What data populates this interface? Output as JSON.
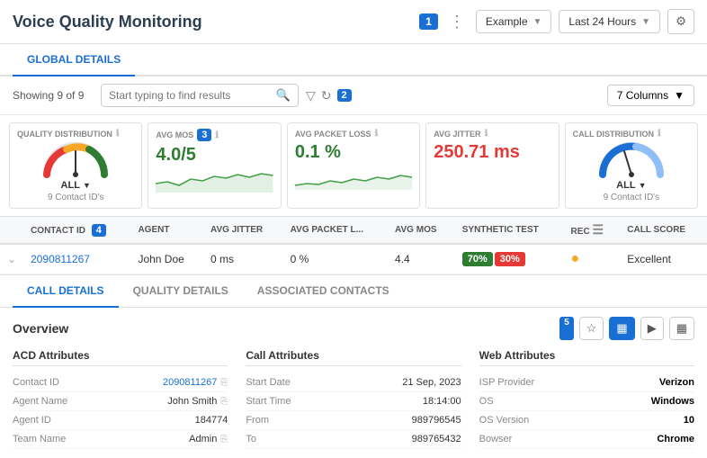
{
  "header": {
    "title": "Voice Quality Monitoring",
    "badge1": "1",
    "example_label": "Example",
    "time_label": "Last 24 Hours",
    "filter_icon": "⚙"
  },
  "global_details_tab": "GLOBAL DETAILS",
  "toolbar": {
    "showing": "Showing 9 of 9",
    "search_placeholder": "Start typing to find results",
    "badge2": "2",
    "columns_label": "7 Columns"
  },
  "metrics": [
    {
      "label": "QUALITY DISTRIBUTION",
      "type": "gauge",
      "tag": "ALL",
      "sub": "9 Contact ID's"
    },
    {
      "label": "AVG MOS",
      "badge": "3",
      "value": "4.0/5",
      "type": "sparkline_green"
    },
    {
      "label": "AVG PACKET LOSS",
      "value": "0.1 %",
      "type": "sparkline_green"
    },
    {
      "label": "AVG JITTER",
      "value": "250.71 ms",
      "type": "plain",
      "color": "red"
    },
    {
      "label": "CALL DISTRIBUTION",
      "type": "gauge_blue",
      "tag": "ALL",
      "sub": "9 Contact ID's"
    }
  ],
  "table": {
    "columns": [
      "CONTACT ID",
      "AGENT",
      "AVG JITTER",
      "AVG PACKET L...",
      "AVG MOS",
      "SYNTHETIC TEST",
      "REC",
      "CALL SCORE"
    ],
    "badge4": "4",
    "rows": [
      {
        "contact_id": "2090811267",
        "agent": "John Doe",
        "avg_jitter": "0 ms",
        "avg_packet_loss": "0 %",
        "avg_mos": "4.4",
        "synthetic_green": "70%",
        "synthetic_red": "30%",
        "rec": "●",
        "call_score": "Excellent"
      }
    ]
  },
  "detail_tabs": [
    "CALL DETAILS",
    "QUALITY DETAILS",
    "ASSOCIATED CONTACTS"
  ],
  "overview": {
    "title": "Overview",
    "badge5": "5"
  },
  "acd_attributes": {
    "title": "ACD Attributes",
    "rows": [
      {
        "key": "Contact ID",
        "value": "2090811267",
        "link": true,
        "copy": true
      },
      {
        "key": "Agent Name",
        "value": "John Smith",
        "copy": true
      },
      {
        "key": "Agent ID",
        "value": "184774"
      },
      {
        "key": "Team Name",
        "value": "Admin",
        "copy": true
      }
    ]
  },
  "call_attributes": {
    "title": "Call Attributes",
    "rows": [
      {
        "key": "Start Date",
        "value": "21 Sep, 2023"
      },
      {
        "key": "Start Time",
        "value": "18:14:00"
      },
      {
        "key": "From",
        "value": "989796545"
      },
      {
        "key": "To",
        "value": "989765432"
      }
    ]
  },
  "web_attributes": {
    "title": "Web  Attributes",
    "rows": [
      {
        "key": "ISP Provider",
        "value": "Verizon",
        "bold": true
      },
      {
        "key": "OS",
        "value": "Windows",
        "bold": true
      },
      {
        "key": "OS Version",
        "value": "10",
        "bold": true
      },
      {
        "key": "Bowser",
        "value": "Chrome",
        "bold": true
      }
    ]
  }
}
